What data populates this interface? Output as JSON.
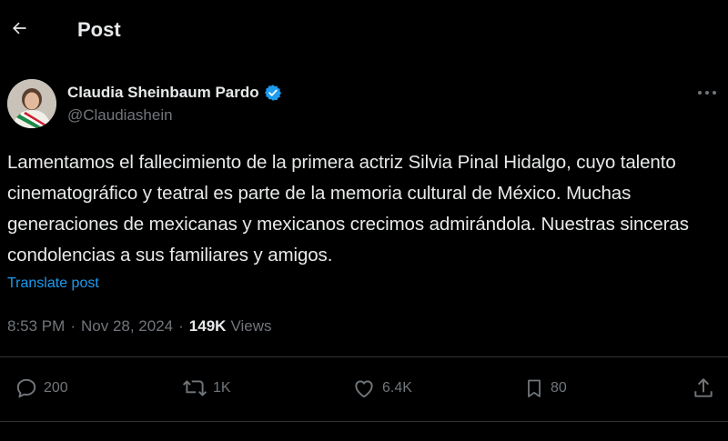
{
  "header": {
    "title": "Post",
    "back_icon": "arrow-left-icon"
  },
  "author": {
    "name": "Claudia Sheinbaum Pardo",
    "handle": "@Claudiashein",
    "verified_icon": "verified-badge-icon",
    "verified_color": "#1d9bf0"
  },
  "post": {
    "text": "Lamentamos el fallecimiento de la primera actriz Silvia Pinal Hidalgo, cuyo talento cinematográfico y teatral es parte de la memoria cultural de México. Muchas generaciones de mexicanas y mexicanos crecimos admirándola. Nuestras sinceras condolencias a sus familiares y amigos.",
    "translate_label": "Translate post",
    "time": "8:53 PM",
    "separator": "·",
    "date": "Nov 28, 2024",
    "views_count": "149K",
    "views_label": "Views"
  },
  "actions": {
    "replies": "200",
    "reposts": "1K",
    "likes": "6.4K",
    "bookmarks": "80"
  },
  "colors": {
    "background": "#000000",
    "text": "#e7e9ea",
    "muted": "#71767b",
    "link": "#1d9bf0",
    "divider": "#2f3336"
  }
}
